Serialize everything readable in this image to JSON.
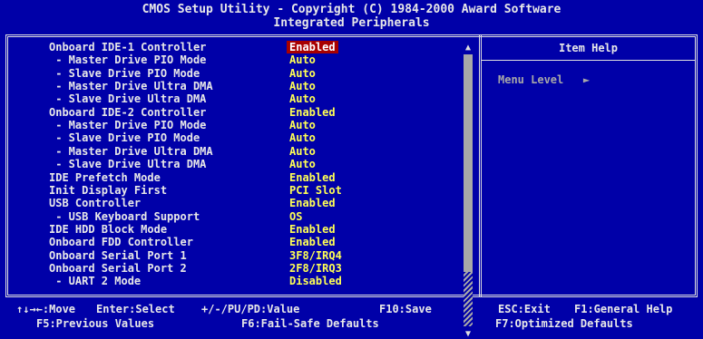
{
  "title": {
    "line1": "CMOS Setup Utility - Copyright (C) 1984-2000 Award Software",
    "line2": "Integrated Peripherals"
  },
  "settings": [
    {
      "label": "Onboard IDE-1 Controller",
      "value": "Enabled",
      "selected": true
    },
    {
      "label": " - Master Drive PIO Mode",
      "value": "Auto"
    },
    {
      "label": " - Slave Drive PIO Mode",
      "value": "Auto"
    },
    {
      "label": " - Master Drive Ultra DMA",
      "value": "Auto"
    },
    {
      "label": " - Slave Drive Ultra DMA",
      "value": "Auto"
    },
    {
      "label": "Onboard IDE-2 Controller",
      "value": "Enabled"
    },
    {
      "label": " - Master Drive PIO Mode",
      "value": "Auto"
    },
    {
      "label": " - Slave Drive PIO Mode",
      "value": "Auto"
    },
    {
      "label": " - Master Drive Ultra DMA",
      "value": "Auto"
    },
    {
      "label": " - Slave Drive Ultra DMA",
      "value": "Auto"
    },
    {
      "label": "IDE Prefetch Mode",
      "value": "Enabled"
    },
    {
      "label": "Init Display First",
      "value": "PCI Slot"
    },
    {
      "label": "USB Controller",
      "value": "Enabled"
    },
    {
      "label": " - USB Keyboard Support",
      "value": "OS"
    },
    {
      "label": "IDE HDD Block Mode",
      "value": "Enabled"
    },
    {
      "label": "Onboard FDD Controller",
      "value": "Enabled"
    },
    {
      "label": "Onboard Serial Port 1",
      "value": "3F8/IRQ4"
    },
    {
      "label": "Onboard Serial Port 2",
      "value": "2F8/IRQ3"
    },
    {
      "label": " - UART 2 Mode",
      "value": "Disabled"
    }
  ],
  "help": {
    "header": "Item Help",
    "menu_level": "Menu Level   ►"
  },
  "scrollbar": {
    "up_arrow": "▲",
    "down_arrow": "▼"
  },
  "footer": {
    "move": "↑↓→←:Move",
    "enter": "Enter:Select",
    "pu_pd": "+/-/PU/PD:Value",
    "f10": "F10:Save",
    "esc": "ESC:Exit",
    "f1": "F1:General Help",
    "f5": "F5:Previous Values",
    "f6": "F6:Fail-Safe Defaults",
    "f7": "F7:Optimized Defaults"
  }
}
